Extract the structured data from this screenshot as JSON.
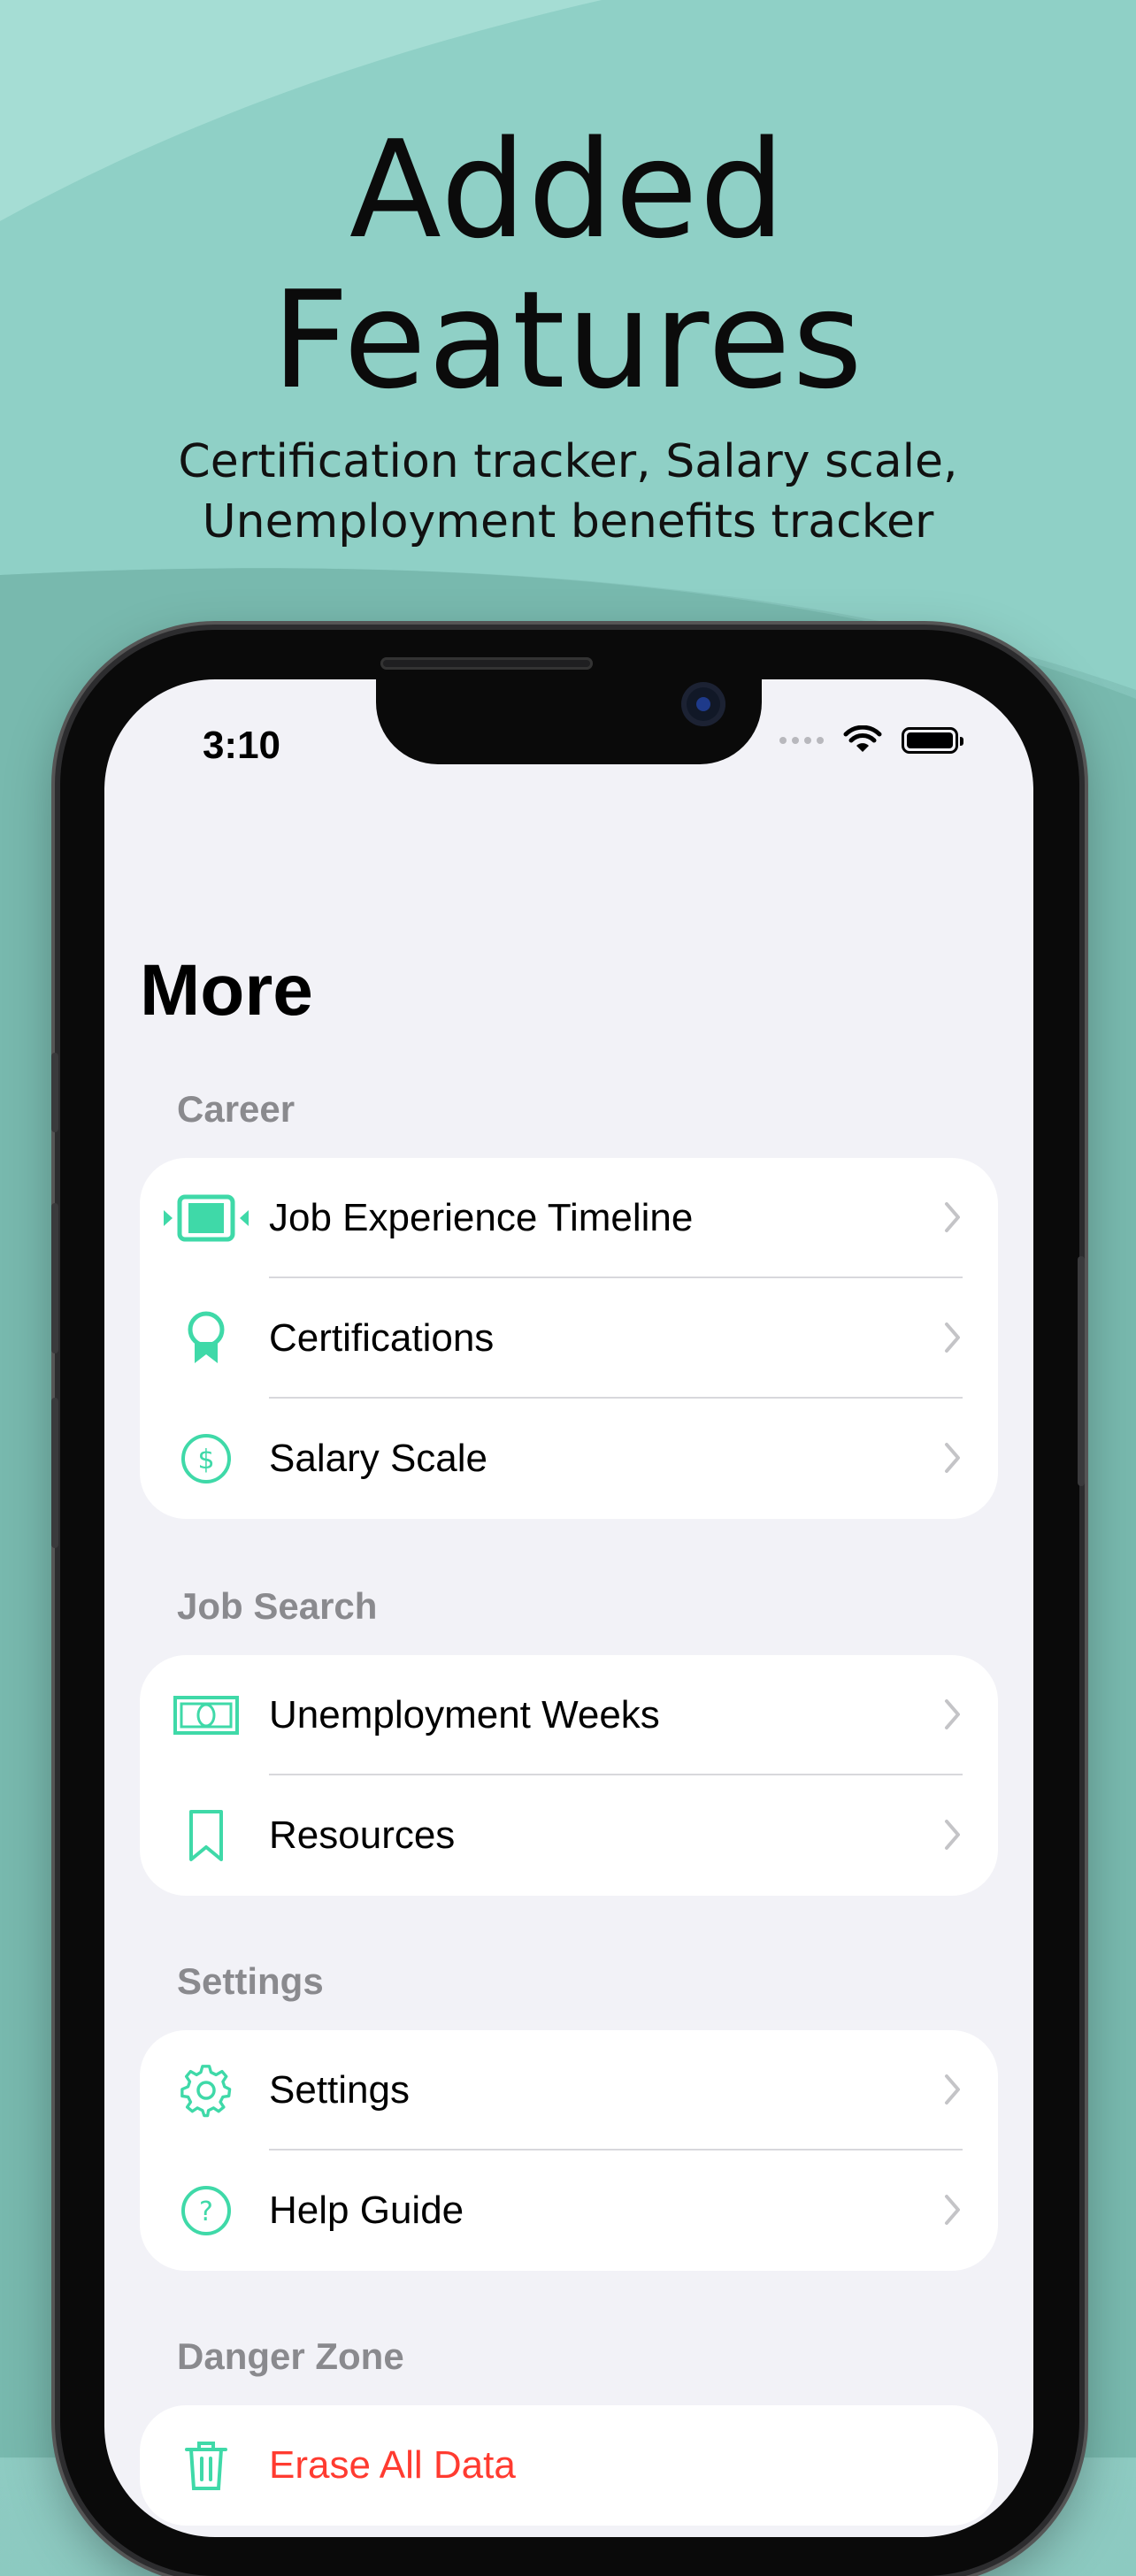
{
  "promo": {
    "headline_line1": "Added",
    "headline_line2": "Features",
    "subtitle_line1": "Certification tracker, Salary scale,",
    "subtitle_line2": "Unemployment benefits tracker"
  },
  "status_bar": {
    "time": "3:10"
  },
  "page": {
    "title": "More"
  },
  "sections": {
    "career": {
      "header": "Career",
      "items": [
        {
          "label": "Job Experience Timeline",
          "icon": "timeline-icon"
        },
        {
          "label": "Certifications",
          "icon": "award-ribbon-icon"
        },
        {
          "label": "Salary Scale",
          "icon": "dollar-circle-icon"
        }
      ]
    },
    "job_search": {
      "header": "Job Search",
      "items": [
        {
          "label": "Unemployment Weeks",
          "icon": "banknote-icon"
        },
        {
          "label": "Resources",
          "icon": "bookmark-icon"
        }
      ]
    },
    "settings": {
      "header": "Settings",
      "items": [
        {
          "label": "Settings",
          "icon": "gear-icon"
        },
        {
          "label": "Help Guide",
          "icon": "question-circle-icon"
        }
      ]
    },
    "danger_zone": {
      "header": "Danger Zone",
      "items": [
        {
          "label": "Erase All Data",
          "icon": "trash-icon"
        }
      ]
    }
  },
  "colors": {
    "accent": "#3fd9a8",
    "danger": "#ff3b30",
    "background": "#f2f2f7",
    "secondary_text": "#8a8a8e"
  }
}
